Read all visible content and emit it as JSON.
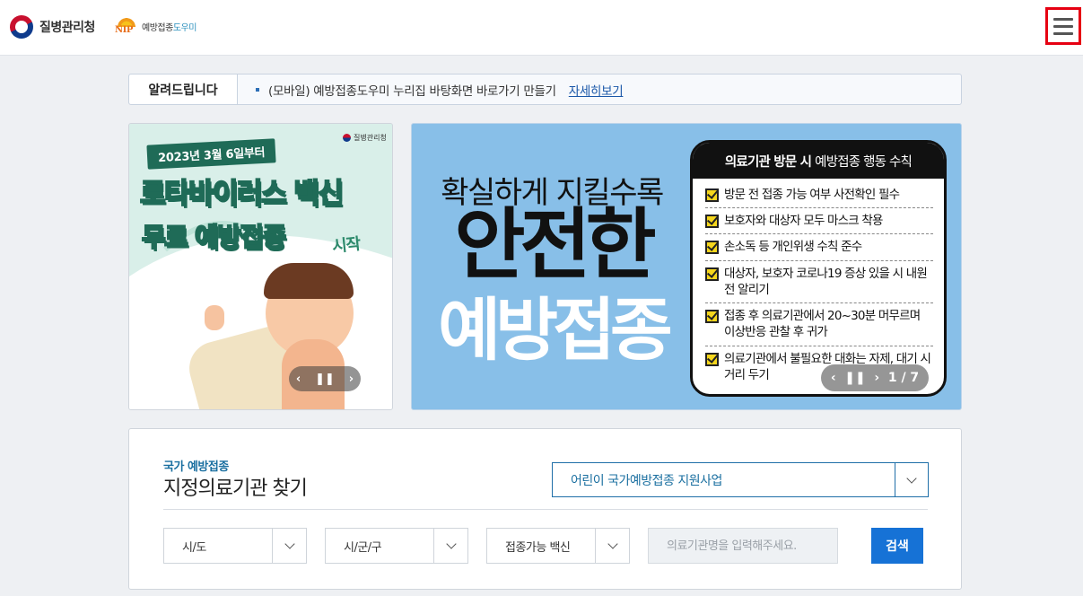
{
  "header": {
    "logo_kdca": "질병관리청",
    "logo_nip_mark": "NIP",
    "logo_nip_text_a": "예방접종",
    "logo_nip_text_b": "도우미",
    "menu_icon": "hamburger-menu-icon"
  },
  "notice": {
    "title": "알려드립니다",
    "text": "(모바일) 예방접종도우미 누리집 바탕화면 바로가기 만들기",
    "link": "자세히보기"
  },
  "banner_left": {
    "logo": "질병관리청",
    "date": "2023년 3월 6일부터",
    "title1": "로타바이러스 백신",
    "title2": "무료 예방접종",
    "title3": "시작",
    "controls": {
      "prev": "‹",
      "pause": "❚❚",
      "next": "›"
    }
  },
  "banner_right": {
    "headline": "확실하게 지킬수록",
    "big1": "안전한",
    "big2": "예방접종",
    "panel_head_bold": "의료기관 방문 시",
    "panel_head_rest": "예방접종 행동 수칙",
    "items": [
      "방문 전 접종 가능 여부 사전확인 필수",
      "보호자와 대상자 모두 마스크 착용",
      "손소독 등 개인위생 수칙 준수",
      "대상자, 보호자 코로나19 증상 있을 시 내원 전 알리기",
      "접종 후 의료기관에서 20~30분 머무르며 이상반응 관찰 후 귀가",
      "의료기관에서 불필요한 대화는 자제, 대기 시 거리 두기"
    ],
    "controls": {
      "prev": "‹",
      "pause": "❚❚",
      "next": "›",
      "page": "1 / 7"
    }
  },
  "search": {
    "subtitle": "국가 예방접종",
    "title": "지정의료기관 찾기",
    "program_value": "어린이 국가예방접종 지원사업",
    "sido": "시/도",
    "sigungu": "시/군/구",
    "vaccine": "접종가능 백신",
    "name_placeholder": "의료기관명을 입력해주세요.",
    "button": "검색"
  }
}
